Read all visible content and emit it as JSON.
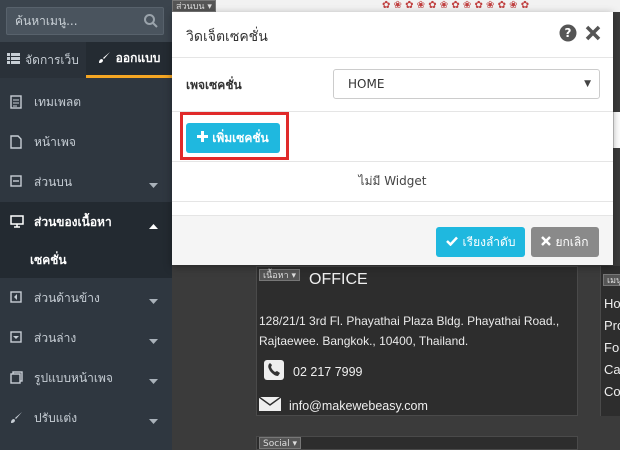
{
  "sidebar": {
    "search_placeholder": "ค้นหาเมนู...",
    "tabs": [
      {
        "label": "จัดการเว็บ",
        "icon": "list-icon"
      },
      {
        "label": "ออกแบบ",
        "icon": "brush-icon",
        "active": true
      }
    ],
    "items": [
      {
        "label": "เทมเพลต",
        "icon": "template-icon"
      },
      {
        "label": "หน้าเพจ",
        "icon": "page-icon"
      },
      {
        "label": "ส่วนบน",
        "icon": "header-icon",
        "caret": "chevron-down-icon"
      },
      {
        "label": "ส่วนของเนื้อหา",
        "icon": "content-icon",
        "caret": "chevron-up-icon",
        "open": true
      },
      {
        "label": "เซคชั่น",
        "sub": true
      },
      {
        "label": "ส่วนด้านข้าง",
        "icon": "sidebar-icon",
        "caret": "chevron-down-icon"
      },
      {
        "label": "ส่วนล่าง",
        "icon": "footer-icon",
        "caret": "chevron-down-icon"
      },
      {
        "label": "รูปแบบหน้าเพจ",
        "icon": "layout-icon",
        "caret": "chevron-down-icon"
      },
      {
        "label": "ปรับแต่ง",
        "icon": "customize-icon",
        "caret": "chevron-down-icon"
      }
    ]
  },
  "page": {
    "top_tag": "ส่วนบน ▾",
    "office_tag": "เนื้อหา ▾",
    "office_title": "OFFICE",
    "office_address": "128/21/1 3rd Fl. Phayathai Plaza Bldg. Phayathai Road., Rajtaewee. Bangkok., 10400, Thailand.",
    "phone": "02 217 7999",
    "email": "info@makewebeasy.com",
    "right_tag": "เมนู",
    "right_lines": [
      "Ho",
      "Pro",
      "For",
      "Ca",
      "Co"
    ],
    "social_tag": "Social ▾"
  },
  "modal": {
    "title": "วิดเจ็ตเซคชั่น",
    "page_section_label": "เพจเซคชั่น",
    "page_section_value": "HOME",
    "add_section_label": "เพิ่มเซคชั่น",
    "empty_text": "ไม่มี Widget",
    "sort_label": "เรียงลำดับ",
    "cancel_label": "ยกเลิก"
  },
  "colors": {
    "accent": "#1fb8df",
    "highlight": "#e02a2a",
    "sidebar_bg": "#2f3740",
    "tab_underline": "#f5a623"
  }
}
